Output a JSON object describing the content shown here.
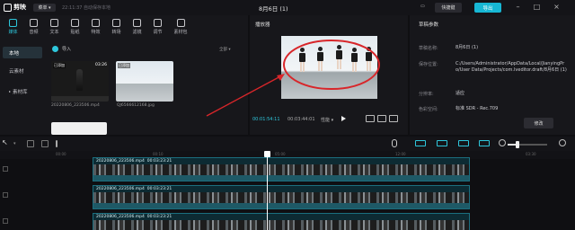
{
  "topbar": {
    "app_name": "剪映",
    "menu_label": "菜单",
    "autosave": "22:11:37 自动保存本地",
    "project_title": "8月6日 (1)",
    "shortcut_label": "快捷键",
    "export_label": "导出"
  },
  "tool_tabs": [
    {
      "label": "媒体",
      "icon": "media-icon",
      "active": true
    },
    {
      "label": "音频",
      "icon": "audio-icon"
    },
    {
      "label": "文本",
      "icon": "text-icon"
    },
    {
      "label": "贴纸",
      "icon": "sticker-icon"
    },
    {
      "label": "特效",
      "icon": "effects-icon"
    },
    {
      "label": "转场",
      "icon": "transition-icon"
    },
    {
      "label": "滤镜",
      "icon": "filter-icon"
    },
    {
      "label": "调节",
      "icon": "adjust-icon"
    },
    {
      "label": "素材包",
      "icon": "package-icon"
    }
  ],
  "media": {
    "nav": [
      "本地",
      "云素材",
      "素材库"
    ],
    "import_label": "导入",
    "filter_label": "全部",
    "items": [
      {
        "badge": "已添加",
        "duration": "03:26",
        "filename": "20220806_223506.mp4"
      },
      {
        "badge": "已添加",
        "duration": "",
        "filename": "QJ6566612168.jpg"
      }
    ]
  },
  "player": {
    "title": "播放器",
    "current_time": "00:01:54:11",
    "total_time": "00:03:44:01",
    "perf_label": "性能"
  },
  "params": {
    "title": "草稿参数",
    "rows": [
      {
        "label": "草稿名称:",
        "value": "8月6日 (1)"
      },
      {
        "label": "保存位置:",
        "value": "C:/Users/Administrator/AppData/Local/JianyingPro/User Data/Projects/com.lveditor.draft/8月6日 (1)"
      },
      {
        "label": "分辨率:",
        "value": "适应"
      },
      {
        "label": "色彩空间:",
        "value": "标准 SDR - Rec.709"
      }
    ],
    "modify_label": "修改"
  },
  "timeline": {
    "ticks": [
      "00:00",
      "00:10",
      "05:00",
      "12:00",
      "03:30"
    ],
    "tracks": [
      {
        "clip_name": "20220806_223506.mp4",
        "clip_duration": "00:03:23:21"
      },
      {
        "clip_name": "20220806_223506.mp4",
        "clip_duration": "00:03:23:21"
      },
      {
        "clip_name": "20220806_223506.mp4",
        "clip_duration": "00:03:23:21"
      }
    ]
  }
}
